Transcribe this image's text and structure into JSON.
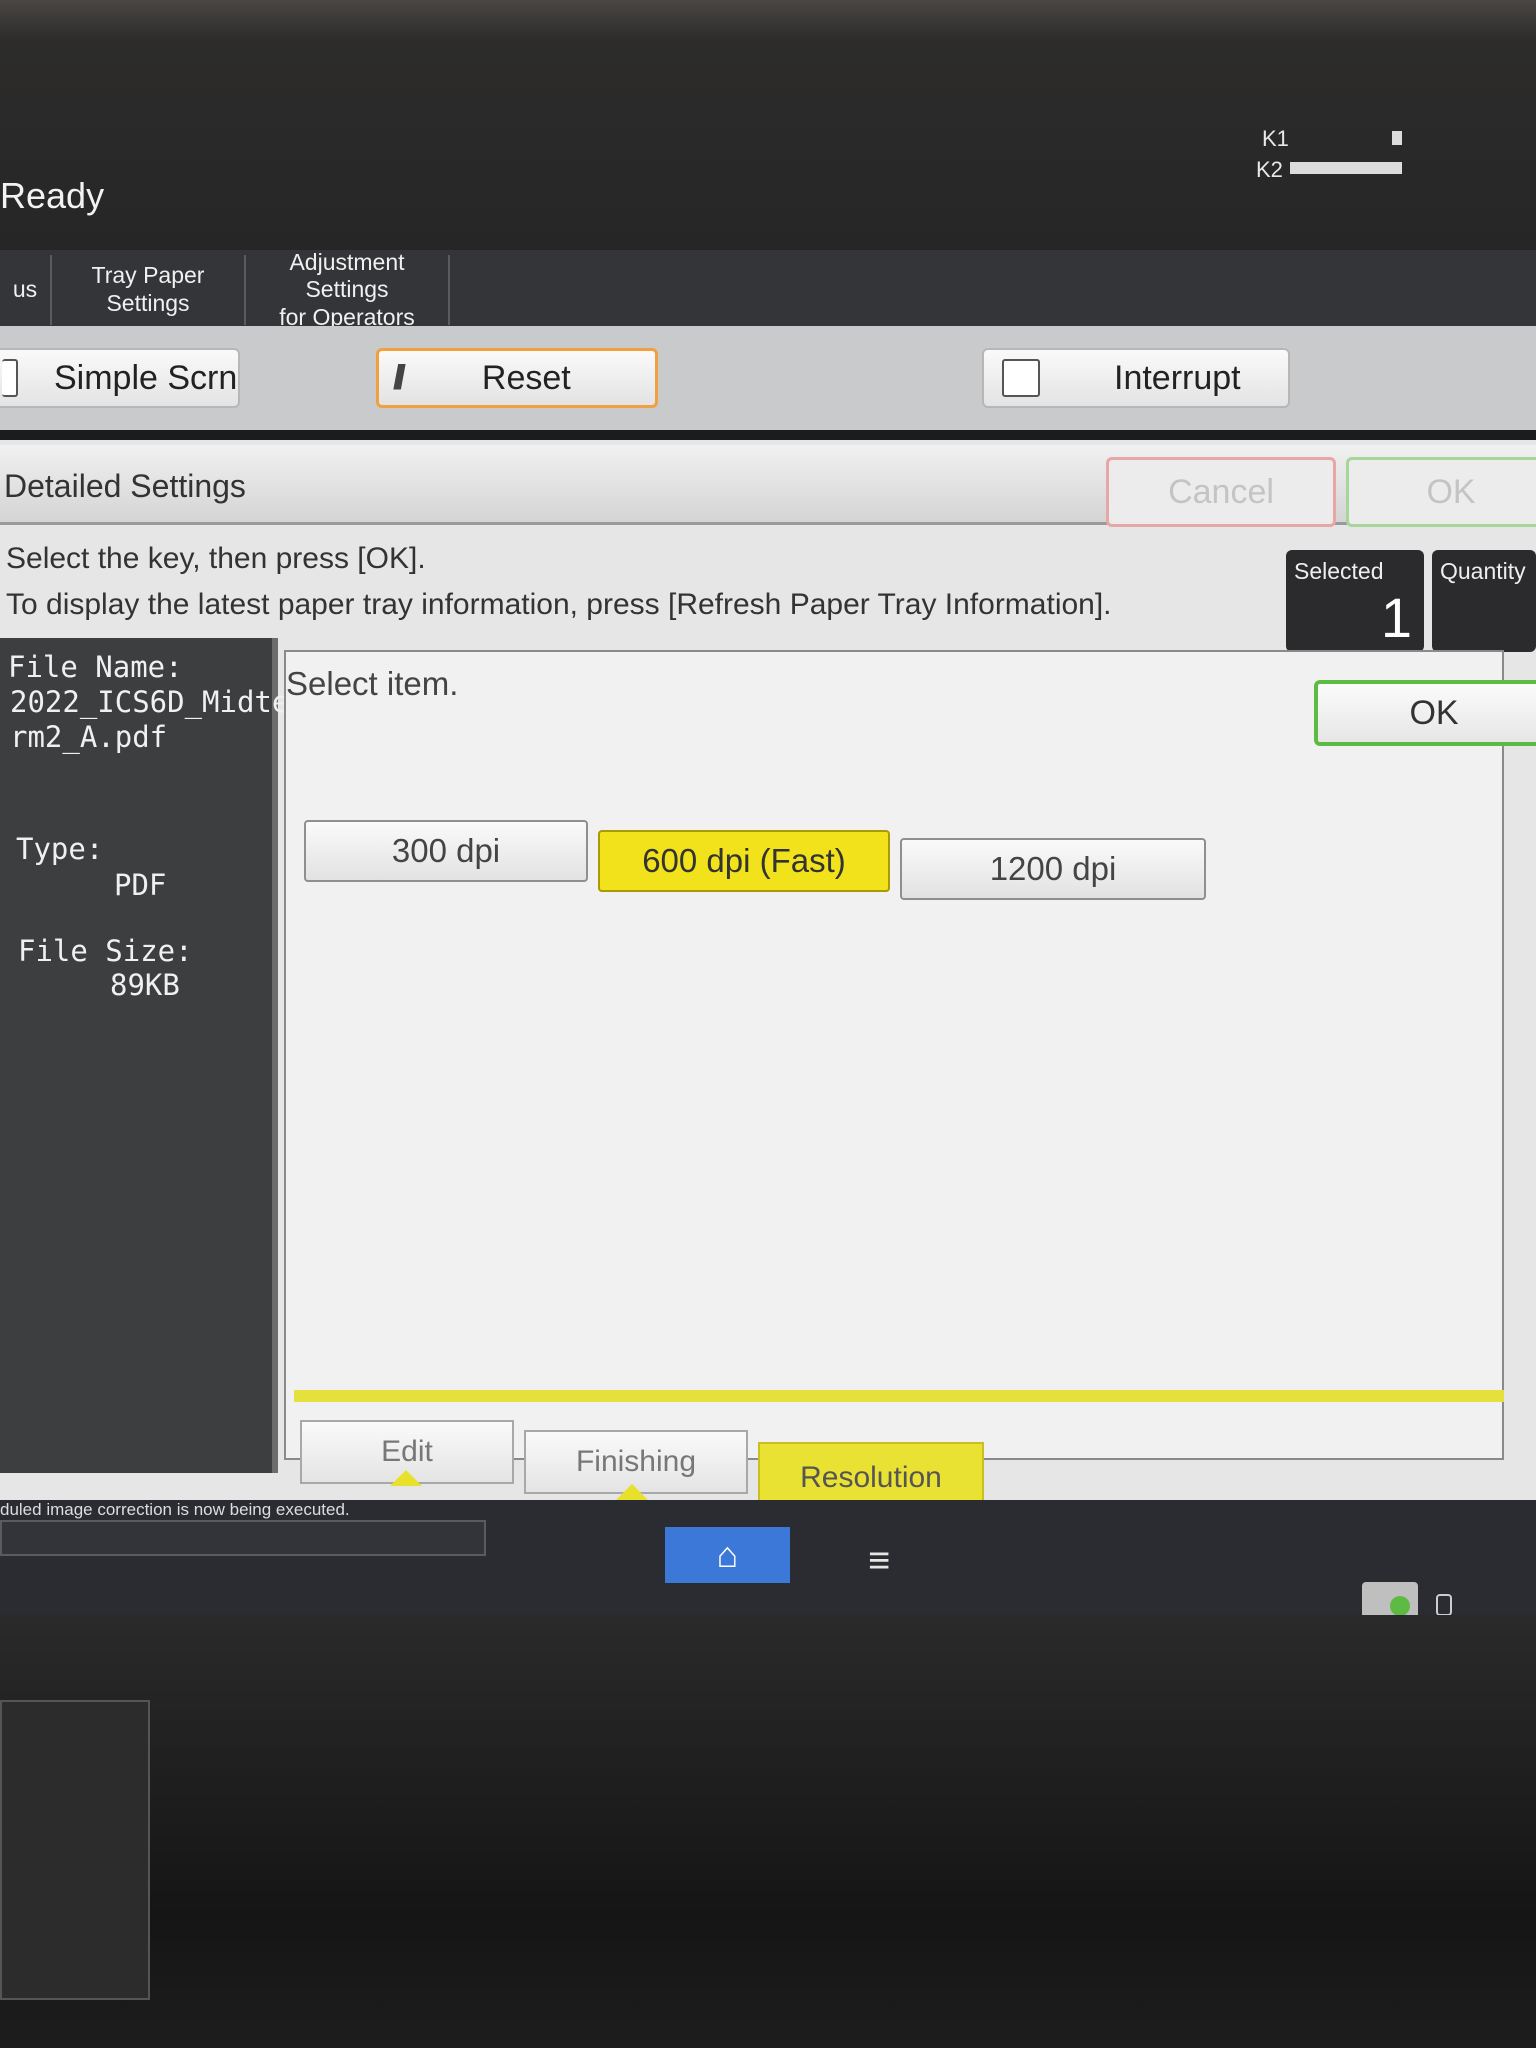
{
  "status": {
    "text": "Ready",
    "toner": [
      {
        "label": "K1",
        "level": 0.1
      },
      {
        "label": "K2",
        "level": 1.0
      }
    ]
  },
  "tabs": [
    {
      "label": "us"
    },
    {
      "label": "Tray Paper Settings"
    },
    {
      "label": "Adjustment Settings\nfor Operators"
    }
  ],
  "controls": {
    "simple_screen": "Simple Scrn",
    "reset": "Reset",
    "interrupt": "Interrupt"
  },
  "dialog": {
    "title": "Detailed Settings",
    "cancel": "Cancel",
    "ok": "OK",
    "instruction_1": "Select the key, then press [OK].",
    "instruction_2": "To display the latest paper tray information, press [Refresh Paper Tray Information].",
    "selected_label": "Selected",
    "selected_value": "1",
    "quantity_label": "Quantity"
  },
  "file_info": {
    "name_label": "File Name:",
    "name_line1": "2022_ICS6D_Midte",
    "name_line2": "rm2_A.pdf",
    "type_label": "Type:",
    "type_value": "PDF",
    "size_label": "File Size:",
    "size_value": "89KB"
  },
  "content": {
    "prompt": "Select item.",
    "ok": "OK",
    "options": [
      {
        "label": "300 dpi",
        "selected": false
      },
      {
        "label": "600 dpi (Fast)",
        "selected": true
      },
      {
        "label": "1200 dpi",
        "selected": false
      }
    ]
  },
  "bottom_tabs": [
    {
      "label": "Edit",
      "active": false
    },
    {
      "label": "Finishing",
      "active": false
    },
    {
      "label": "Resolution",
      "active": true
    }
  ],
  "system_bar": {
    "message": "duled image correction is now being executed."
  },
  "colors": {
    "selected_yellow": "#f2e21b",
    "ok_green": "#5dbb44",
    "home_blue": "#3c78d8"
  }
}
